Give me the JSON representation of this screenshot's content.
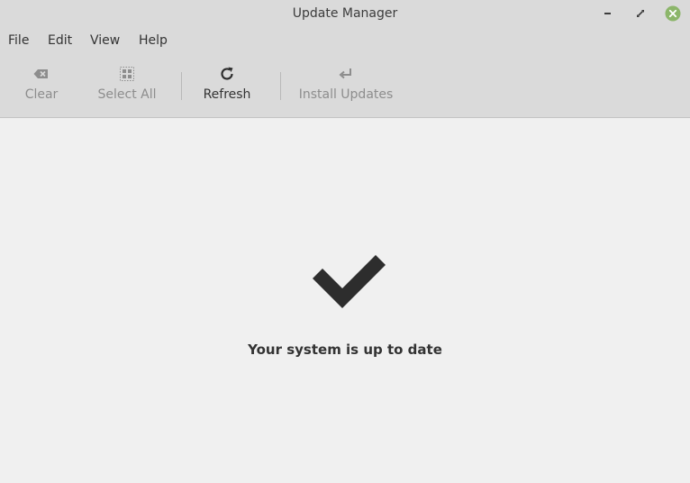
{
  "window": {
    "title": "Update Manager"
  },
  "menu": {
    "items": [
      {
        "label": "File"
      },
      {
        "label": "Edit"
      },
      {
        "label": "View"
      },
      {
        "label": "Help"
      }
    ]
  },
  "toolbar": {
    "clear_label": "Clear",
    "select_all_label": "Select All",
    "refresh_label": "Refresh",
    "install_label": "Install Updates"
  },
  "status": {
    "message": "Your system is up to date",
    "icon": "checkmark-icon"
  },
  "colors": {
    "close_button": "#8cb66a",
    "chrome": "#dadada",
    "background": "#f0f0f0"
  }
}
